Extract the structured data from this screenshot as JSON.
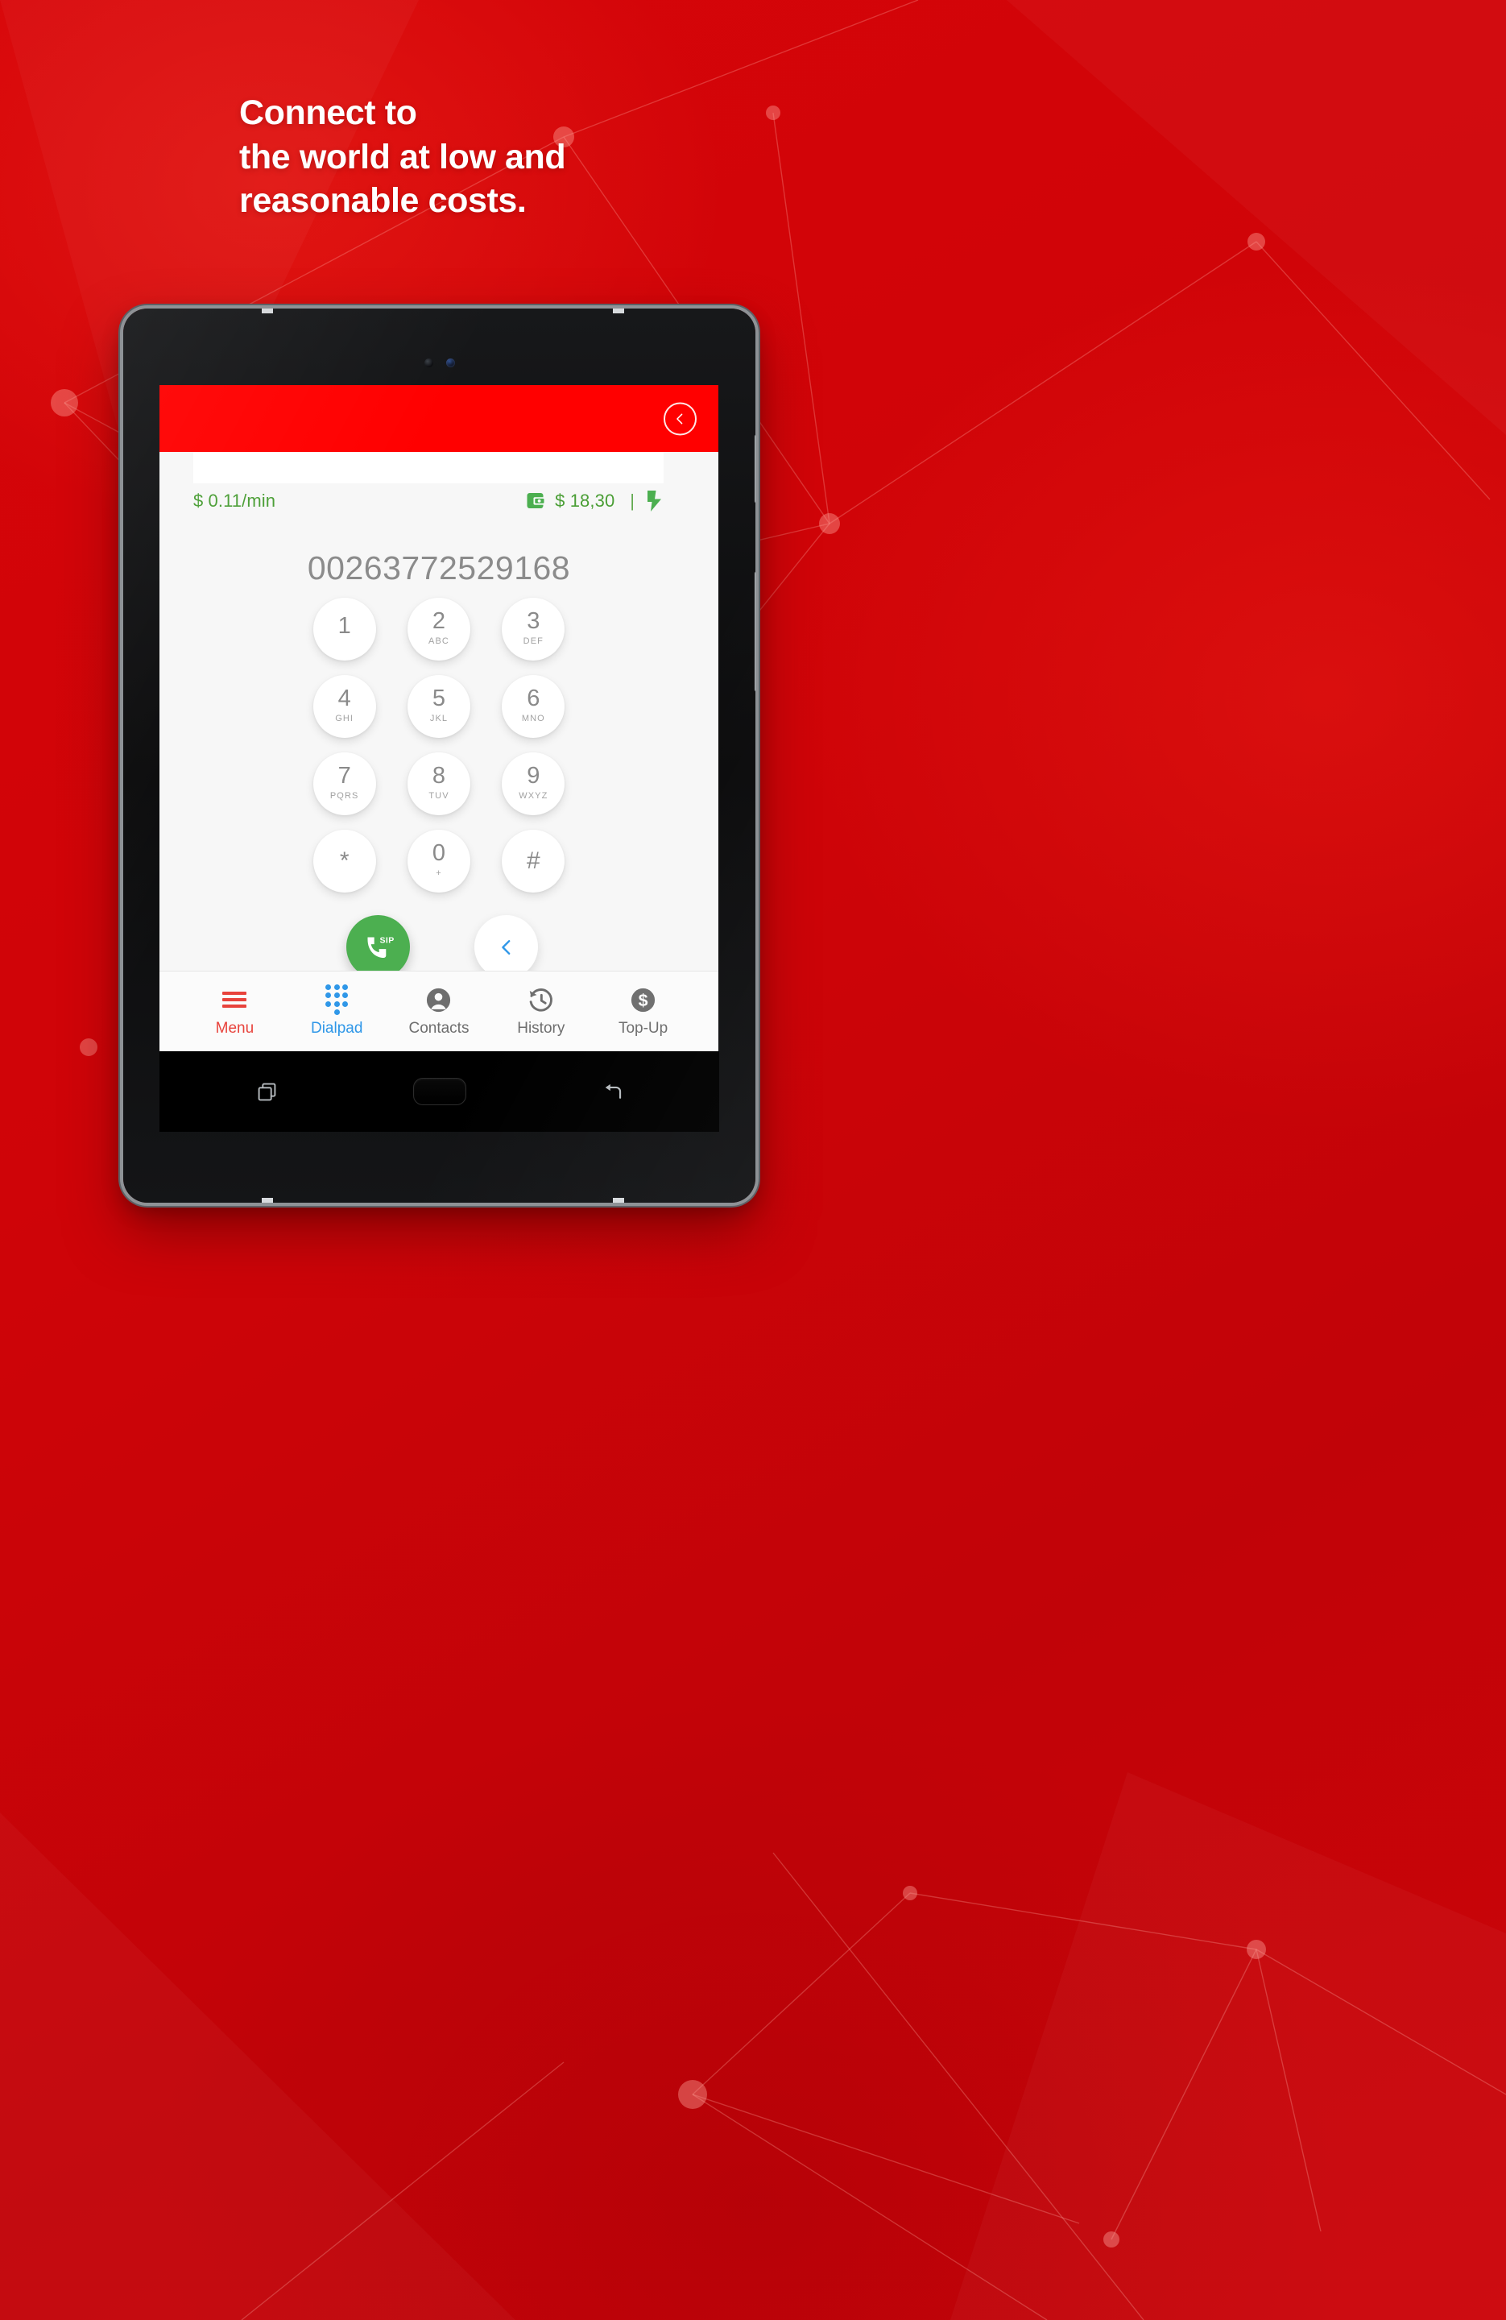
{
  "promo": {
    "background_color": "#cc0409",
    "headline_lines": [
      "Connect to",
      "the world at low and",
      "reasonable costs."
    ]
  },
  "device": {
    "type": "android-tablet",
    "frame_color": "#0b0b0c",
    "bezel_trim_color": "#8e9296",
    "camera_icon": "front-camera-icon",
    "sensor_icon": "proximity-sensor-icon",
    "side_buttons": [
      "volume-button",
      "power-button"
    ]
  },
  "app": {
    "header": {
      "background_color": "#ff0000",
      "back_icon": "chevron-left-circle-icon",
      "back_label": "Back"
    },
    "input_field": {
      "value": "",
      "placeholder": ""
    },
    "status_bar": {
      "rate": "$ 0.11/min",
      "rate_color": "#4a9e35",
      "wallet_icon": "wallet-icon",
      "balance": "$ 18,30",
      "separator": "|",
      "bolt_icon": "lightning-bolt-icon",
      "accent_color": "#4a9e35"
    },
    "dialed_number": "00263772529168",
    "dialpad": {
      "keys": [
        {
          "digit": "1",
          "letters": ""
        },
        {
          "digit": "2",
          "letters": "ABC"
        },
        {
          "digit": "3",
          "letters": "DEF"
        },
        {
          "digit": "4",
          "letters": "GHI"
        },
        {
          "digit": "5",
          "letters": "JKL"
        },
        {
          "digit": "6",
          "letters": "MNO"
        },
        {
          "digit": "7",
          "letters": "PQRS"
        },
        {
          "digit": "8",
          "letters": "TUV"
        },
        {
          "digit": "9",
          "letters": "WXYZ"
        },
        {
          "digit": "*",
          "letters": ""
        },
        {
          "digit": "0",
          "letters": "+"
        },
        {
          "digit": "#",
          "letters": ""
        }
      ]
    },
    "actions": {
      "call": {
        "icon": "phone-sip-call-icon",
        "badge": "SIP",
        "color": "#4caf50",
        "label": "Call"
      },
      "backspace": {
        "icon": "chevron-left-icon",
        "color": "#2f97e8",
        "label": "Backspace"
      }
    },
    "bottom_nav": {
      "active": "Dialpad",
      "items": [
        {
          "label": "Menu",
          "icon": "hamburger-menu-icon",
          "color": "#e8433c"
        },
        {
          "label": "Dialpad",
          "icon": "dialpad-dots-icon",
          "color": "#2f97e8"
        },
        {
          "label": "Contacts",
          "icon": "person-circle-icon",
          "color": "#6e6e6e"
        },
        {
          "label": "History",
          "icon": "clock-history-icon",
          "color": "#6e6e6e"
        },
        {
          "label": "Top-Up",
          "icon": "dollar-circle-icon",
          "color": "#6e6e6e"
        }
      ]
    }
  },
  "android_nav": {
    "recents_icon": "recents-square-icon",
    "home_icon": "home-key-icon",
    "back_icon": "back-arrow-icon"
  }
}
